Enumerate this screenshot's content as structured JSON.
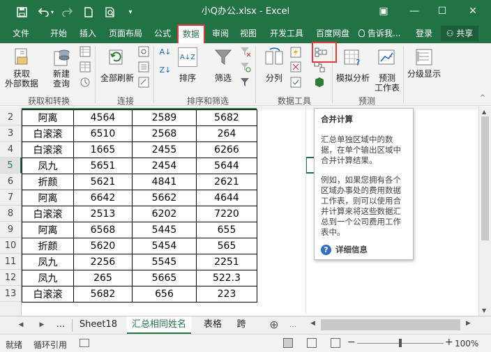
{
  "window": {
    "title": "小Q办公.xlsx - Excel",
    "ribbon_options_glyph": "▣",
    "minimize_glyph": "—",
    "maximize_glyph": "☐",
    "close_glyph": "✕"
  },
  "quick_access": {
    "save_icon": "save-icon",
    "undo_icon": "undo-icon",
    "redo_icon": "redo-icon",
    "new_icon": "new-file-icon",
    "preview_icon": "print-preview-icon",
    "customize_icon": "customize-dropdown-icon"
  },
  "tabs": [
    "文件",
    "开始",
    "插入",
    "页面布局",
    "公式",
    "数据",
    "审阅",
    "视图",
    "开发工具",
    "百度网盘"
  ],
  "active_tab": "数据",
  "tell_me": "告诉我...",
  "login": "登录",
  "share": "共享",
  "ribbon": {
    "get_data": "获取\n外部数据",
    "new_query": "新建\n查询",
    "refresh_all": "全部刷新",
    "sort": "排序",
    "filter": "筛选",
    "split_column": "分列",
    "what_if": "模拟分析",
    "forecast_sheet": "预测\n工作表",
    "group_display": "分级显示",
    "groups": [
      "获取和转换",
      "连接",
      "排序和筛选",
      "数据工具",
      "预测"
    ],
    "sort_icon_text": "A↓Z",
    "sort_az": "A↓",
    "sort_za": "Z↓"
  },
  "rows": [
    {
      "num": "2",
      "name": "阿离",
      "a": "4564",
      "b": "2589",
      "c": "5682"
    },
    {
      "num": "3",
      "name": "白滚滚",
      "a": "6510",
      "b": "2568",
      "c": "264"
    },
    {
      "num": "4",
      "name": "白滚滚",
      "a": "1665",
      "b": "2455",
      "c": "6266"
    },
    {
      "num": "5",
      "name": "凤九",
      "a": "5651",
      "b": "2454",
      "c": "5644"
    },
    {
      "num": "6",
      "name": "折颜",
      "a": "5621",
      "b": "4841",
      "c": "2621"
    },
    {
      "num": "7",
      "name": "阿离",
      "a": "6642",
      "b": "5662",
      "c": "4644"
    },
    {
      "num": "8",
      "name": "白滚滚",
      "a": "2513",
      "b": "6202",
      "c": "7220"
    },
    {
      "num": "9",
      "name": "阿离",
      "a": "6568",
      "b": "5445",
      "c": "655"
    },
    {
      "num": "10",
      "name": "折颜",
      "a": "5620",
      "b": "5454",
      "c": "565"
    },
    {
      "num": "11",
      "name": "凤九",
      "a": "2256",
      "b": "5545",
      "c": "2251"
    },
    {
      "num": "12",
      "name": "凤九",
      "a": "265",
      "b": "5665",
      "c": "522.3"
    },
    {
      "num": "13",
      "name": "白滚滚",
      "a": "5682",
      "b": "656",
      "c": "223"
    }
  ],
  "tooltip": {
    "title": "合并计算",
    "p1": "汇总单独区域中的数据，在单个输出区域中合并计算结果。",
    "p2": "例如，如果您拥有各个区域办事处的费用数据工作表，则可以使用合并计算来将这些数据汇总到一个公司费用工作表中。",
    "more": "详细信息"
  },
  "sheets": {
    "ellipsis": "...",
    "tab1": "Sheet18",
    "tab2": "汇总相同姓名",
    "tab3": "表格",
    "tab4": "跨",
    "add_glyph": "⊕",
    "overflow": "...",
    "nav_prev": "◀",
    "nav_next": "▶"
  },
  "status": {
    "ready": "就绪",
    "circular": "循环引用",
    "zoom": "100%",
    "zoom_minus": "−",
    "zoom_plus": "+"
  },
  "colors": {
    "brand": "#217346",
    "highlight": "#e53935"
  }
}
